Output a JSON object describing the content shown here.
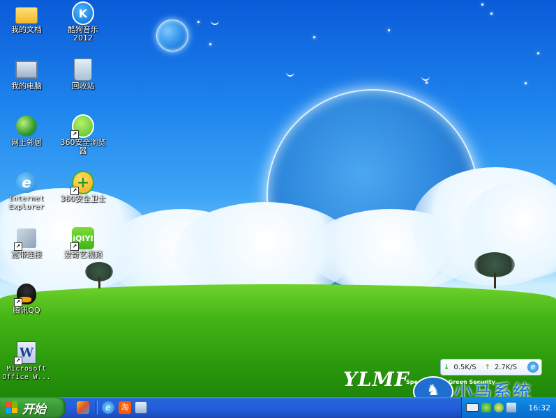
{
  "desktop": {
    "icons": [
      {
        "label": "我的文档"
      },
      {
        "label": "酷狗音乐\n2012"
      },
      {
        "label": "我的电脑"
      },
      {
        "label": "回收站"
      },
      {
        "label": "网上邻居"
      },
      {
        "label": "360安全浏览\n器"
      },
      {
        "label": "Internet\nExplorer"
      },
      {
        "label": "360安全卫士"
      },
      {
        "label": "宽带连接"
      },
      {
        "label": "爱奇艺视频"
      },
      {
        "label": "腾讯QQ"
      },
      {
        "label": "Microsoft\nOffice W..."
      }
    ],
    "icon_glyphs": {
      "kugou": "K",
      "ie": "e",
      "guard360": "+",
      "iqiyi": "iQIYI",
      "word": "W",
      "shortcut_arrow": "↗"
    },
    "wallpaper": {
      "logo_text": "YLMF",
      "slogan": "Speed, Pure, Green Security"
    }
  },
  "net_meter": {
    "down_arrow": "↓",
    "down_speed": "0.5K/S",
    "up_arrow": "↑",
    "up_speed": "2.7K/S",
    "icon": "e"
  },
  "watermark": {
    "logo": "♞",
    "text": "小马系统"
  },
  "taskbar": {
    "start_label": "开始",
    "quick_launch": {
      "ie": "e",
      "taobao": "淘"
    },
    "clock": "16:32"
  },
  "colors": {
    "taskbar_blue": "#245edb",
    "start_green": "#3c9d37",
    "tray_blue": "#0b7ad9"
  }
}
